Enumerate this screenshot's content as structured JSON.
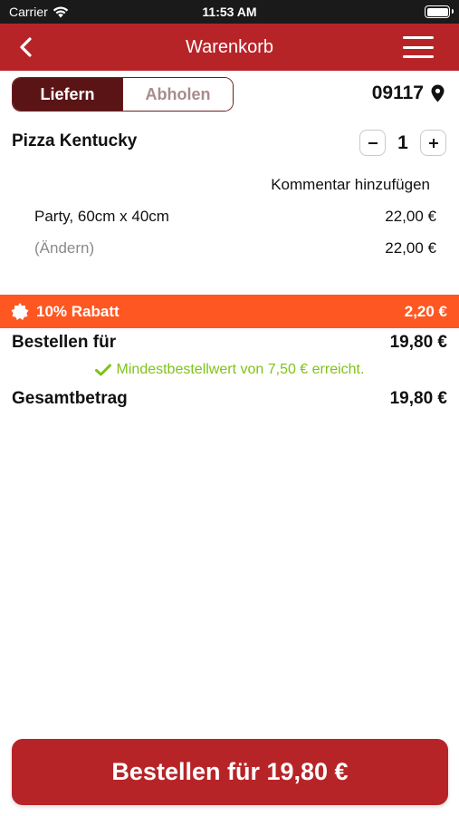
{
  "status_bar": {
    "carrier": "Carrier",
    "time": "11:53 AM"
  },
  "header": {
    "title": "Warenkorb"
  },
  "mode": {
    "deliver": "Liefern",
    "pickup": "Abholen",
    "selected": "Liefern"
  },
  "location": {
    "zip": "09117"
  },
  "cart": {
    "item": {
      "name": "Pizza Kentucky",
      "quantity": "1",
      "comment_label": "Kommentar hinzufügen",
      "size_label": "Party, 60cm x 40cm",
      "size_price": "22,00 €",
      "change_label": "(Ändern)",
      "item_total": "22,00 €"
    }
  },
  "discount": {
    "label": "10% Rabatt",
    "amount": "2,20 €"
  },
  "summary": {
    "order_label": "Bestellen für",
    "order_value": "19,80 €",
    "min_order_note": "Mindestbestellwert von 7,50 € erreicht.",
    "total_label": "Gesamtbetrag",
    "total_value": "19,80 €"
  },
  "cta": {
    "label": "Bestellen für 19,80 €"
  },
  "colors": {
    "brand": "#b72428",
    "dark": "#5a1416",
    "discount": "#ff5722",
    "success": "#7fc21b"
  }
}
